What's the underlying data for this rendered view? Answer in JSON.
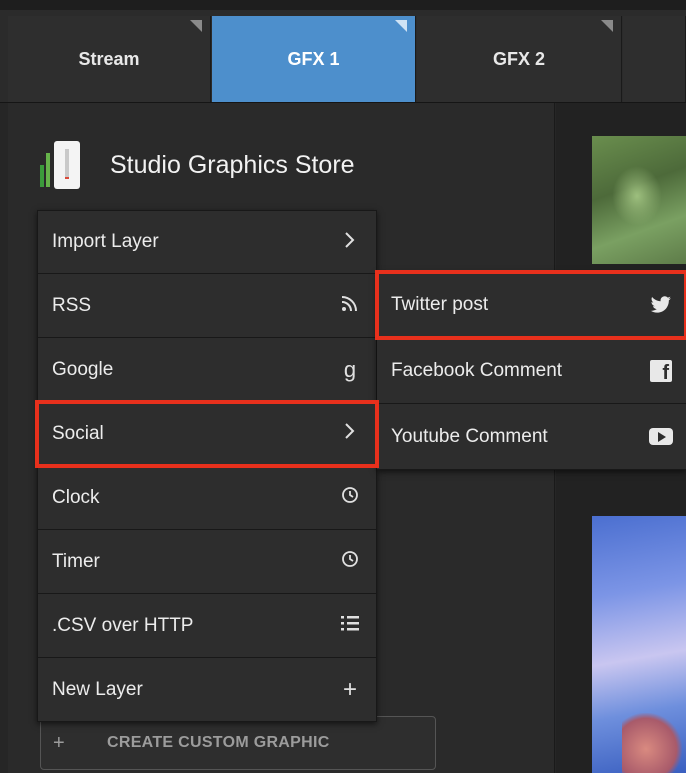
{
  "tabs": [
    {
      "label": "Stream",
      "active": false
    },
    {
      "label": "GFX 1",
      "active": true
    },
    {
      "label": "GFX 2",
      "active": false
    }
  ],
  "store": {
    "title": "Studio Graphics Store"
  },
  "menu": {
    "items": [
      {
        "label": "Import Layer",
        "icon": "chevron-right-icon",
        "glyph": "›"
      },
      {
        "label": "RSS",
        "icon": "rss-icon",
        "glyph": ""
      },
      {
        "label": "Google",
        "icon": "google-icon",
        "glyph": "g"
      },
      {
        "label": "Social",
        "icon": "chevron-right-icon",
        "glyph": "›",
        "highlighted": true
      },
      {
        "label": "Clock",
        "icon": "clock-icon",
        "glyph": ""
      },
      {
        "label": "Timer",
        "icon": "clock-icon",
        "glyph": ""
      },
      {
        "label": ".CSV over HTTP",
        "icon": "list-icon",
        "glyph": ""
      },
      {
        "label": "New Layer",
        "icon": "plus-icon",
        "glyph": "+"
      }
    ]
  },
  "submenu": {
    "items": [
      {
        "label": "Twitter post",
        "icon": "twitter-icon",
        "highlighted": true
      },
      {
        "label": "Facebook Comment",
        "icon": "facebook-icon"
      },
      {
        "label": "Youtube Comment",
        "icon": "youtube-icon"
      }
    ]
  },
  "create_button": {
    "plus": "+",
    "label": "CREATE CUSTOM GRAPHIC"
  },
  "colors": {
    "accent": "#4d8fcc",
    "highlight": "#e8301c"
  }
}
